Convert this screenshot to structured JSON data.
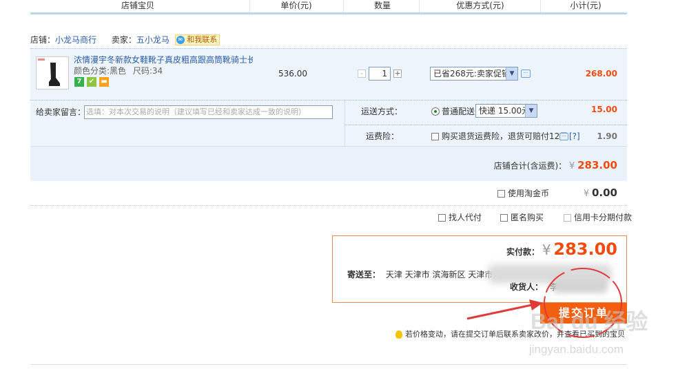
{
  "table_header": {
    "col_item": "店铺宝贝",
    "col_price": "单价(元)",
    "col_qty": "数量",
    "col_discount": "优惠方式(元)",
    "col_subtotal": "小计(元)"
  },
  "shop": {
    "shop_label": "店铺：",
    "shop_name": "小龙马商行",
    "seller_label": "卖家：",
    "seller_name": "五小龙马",
    "contact_label": "和我联系"
  },
  "item": {
    "title": "浓情漫宇冬新款女鞋靴子真皮粗高跟高筒靴骑士长...",
    "attr_color": "颜色分类:黑色",
    "attr_size": "尺码:34",
    "price": "536.00",
    "quantity": "1",
    "discount_option": "已省268元:卖家促销",
    "subtotal": "268.00",
    "minus": "-",
    "plus": "+"
  },
  "message": {
    "label": "给卖家留言：",
    "placeholder": "选填：对本次交易的说明（建议填写已经和卖家达成一致的说明）"
  },
  "shipping": {
    "label": "运送方式：",
    "method": "普通配送",
    "option": "快递 15.00元",
    "cost": "15.00"
  },
  "insurance": {
    "label": "运费险：",
    "text": "购买退货运费险，退货可赔付12元",
    "help": "[?]",
    "cost": "1.90"
  },
  "shop_total": {
    "label": "店铺合计(含运费)：",
    "currency": "¥",
    "amount": "283.00"
  },
  "taojinbi": {
    "label": "使用淘金币",
    "currency": "¥",
    "amount": "0.00"
  },
  "options": {
    "proxy_pay": "找人代付",
    "anonymous": "匿名购买",
    "installment": "信用卡分期付款"
  },
  "summary": {
    "pay_label": "实付款：",
    "currency": "¥",
    "amount": "283.00",
    "ship_to_label": "寄送至：",
    "address": "天津 天津市 滨海新区 天津市大",
    "receiver_label": "收货人：",
    "receiver": "李"
  },
  "submit": {
    "label": "提交订单"
  },
  "notice": {
    "text": "若价格变动，请在提交订单后联系卖家改价，并查看已买到的宝贝"
  },
  "watermark": {
    "brand": "Bai du 经验",
    "url": "jingyan.baidu.com"
  },
  "colors": {
    "accent_orange": "#f24b0f",
    "link_blue": "#2a5caa",
    "header_line": "#b8d7f0",
    "panel_bg": "#eef4fb",
    "submit_bg": "#f25f10",
    "annotation_red": "#e03a3a"
  }
}
